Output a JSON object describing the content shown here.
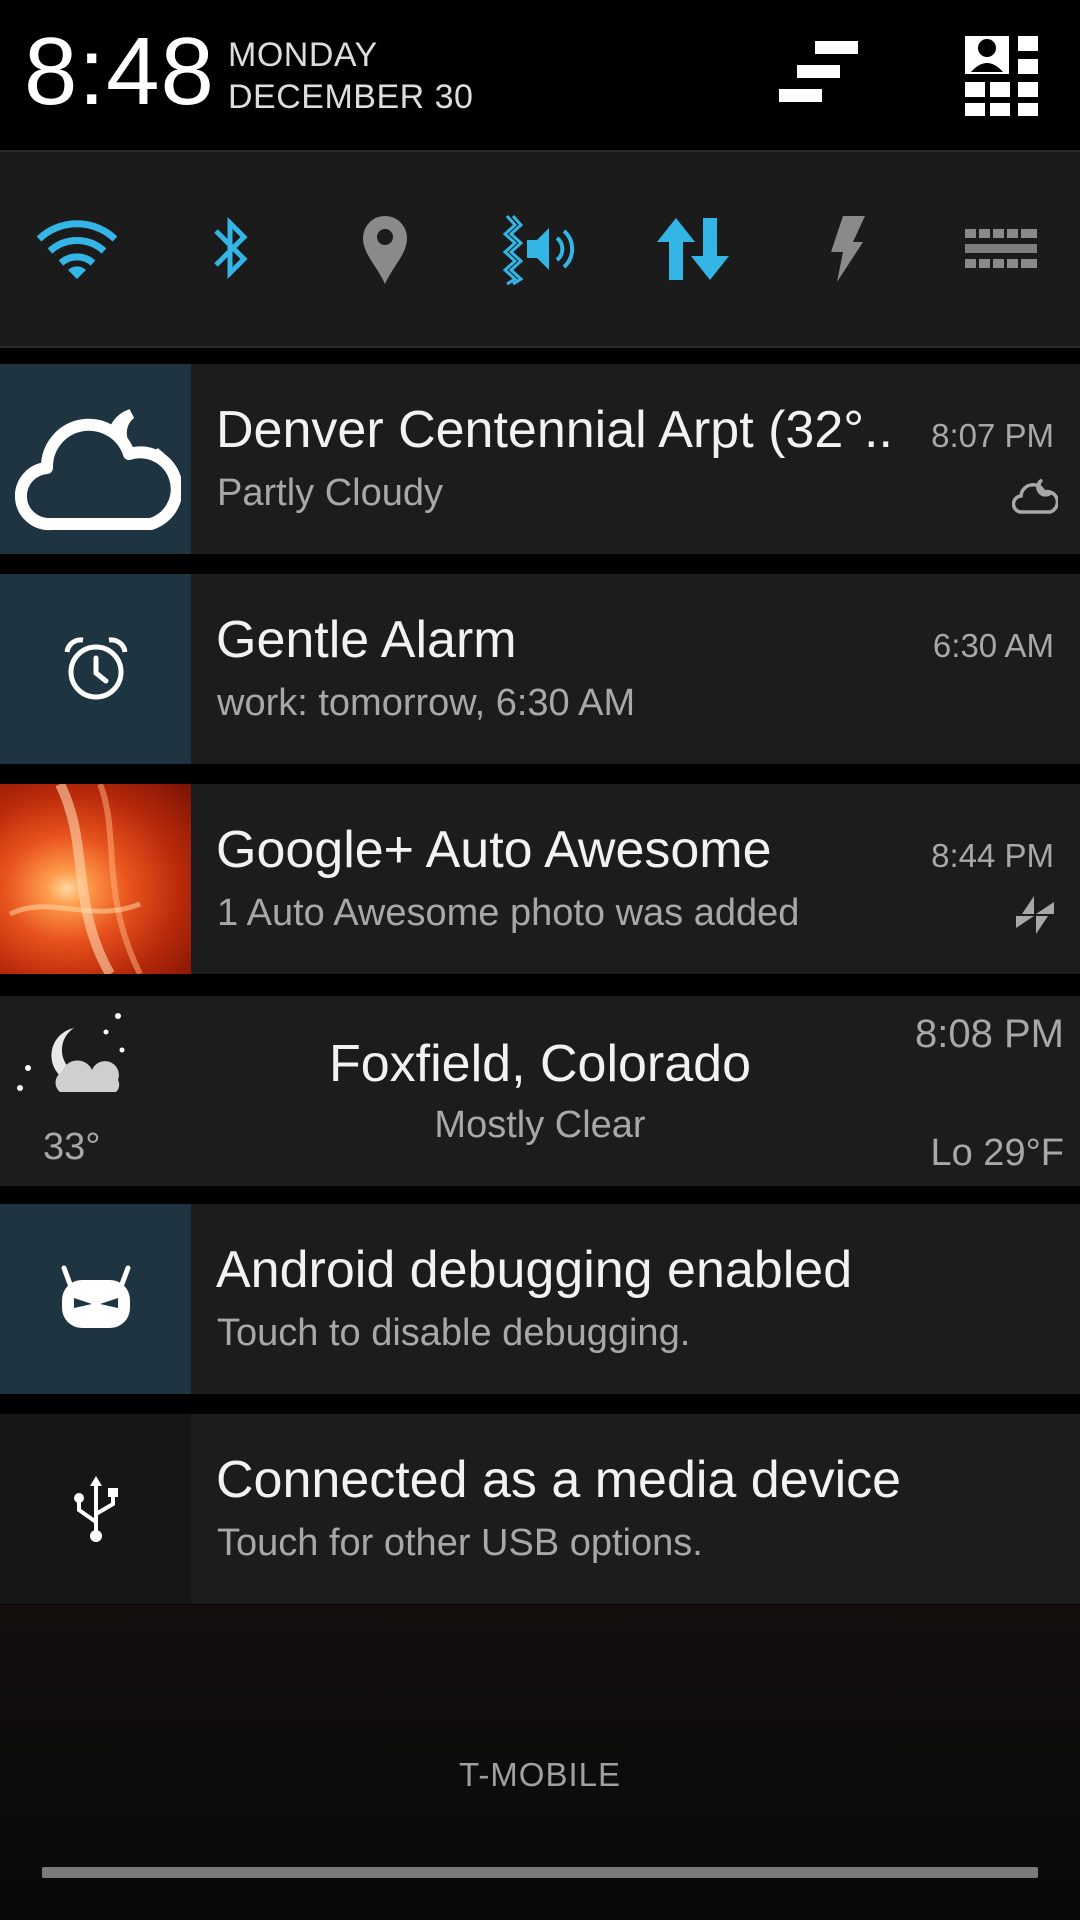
{
  "status_header": {
    "time": "8:48",
    "day": "MONDAY",
    "date": "DECEMBER 30",
    "clear_all_icon": "clear-all-icon",
    "quick_settings_icon": "quick-settings-icon"
  },
  "quick_settings": {
    "accent_color": "#33b5e5",
    "inactive_color": "#8a8a8a",
    "tiles": [
      {
        "name": "wifi",
        "icon": "wifi-icon",
        "active": true
      },
      {
        "name": "bluetooth",
        "icon": "bluetooth-icon",
        "active": true
      },
      {
        "name": "location",
        "icon": "location-icon",
        "active": false
      },
      {
        "name": "sound-vibrate",
        "icon": "vibrate-sound-icon",
        "active": true
      },
      {
        "name": "mobile-data",
        "icon": "data-arrows-icon",
        "active": true
      },
      {
        "name": "torch",
        "icon": "lightning-icon",
        "active": false
      },
      {
        "name": "keyboard",
        "icon": "keyboard-icon",
        "active": false
      }
    ]
  },
  "notifications": [
    {
      "id": "weather-denver",
      "icon": "partly-cloudy-night-icon",
      "title": "Denver Centennial Arpt (32°..",
      "text": "Partly Cloudy",
      "time": "8:07 PM",
      "small_icon": "cloud-moon-small-icon"
    },
    {
      "id": "gentle-alarm",
      "icon": "alarm-clock-icon",
      "title": "Gentle Alarm",
      "text": "work: tomorrow, 6:30 AM",
      "time": "6:30 AM"
    },
    {
      "id": "google-plus",
      "icon": "photo-thumbnail",
      "title": "Google+ Auto Awesome",
      "text": "1 Auto Awesome photo was added",
      "time": "8:44 PM",
      "small_icon": "pinwheel-icon"
    },
    {
      "id": "android-debugging",
      "icon": "cyanogen-bugdroid-icon",
      "title": "Android debugging enabled",
      "text": "Touch to disable debugging."
    },
    {
      "id": "usb-media",
      "icon": "usb-icon",
      "title": "Connected as a media device",
      "text": "Touch for other USB options."
    }
  ],
  "weather_widget": {
    "icon": "moon-cloud-stars-icon",
    "temperature": "33°",
    "city": "Foxfield, Colorado",
    "condition": "Mostly Clear",
    "time": "8:08 PM",
    "low": "Lo 29°F"
  },
  "footer": {
    "carrier": "T-MOBILE"
  }
}
